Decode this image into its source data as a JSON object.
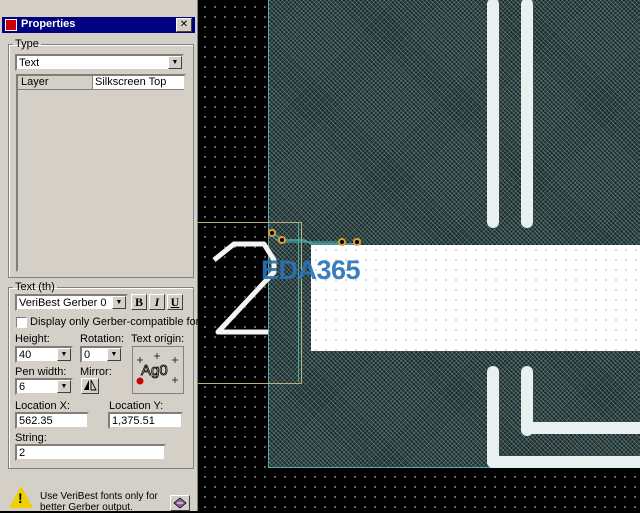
{
  "window": {
    "title": "Properties",
    "close_glyph": "✕"
  },
  "type_group": {
    "label": "Type",
    "selected": "Text"
  },
  "layer_table": {
    "key": "Layer",
    "value": "Silkscreen Top"
  },
  "text_group": {
    "label": "Text (th)",
    "font": "VeriBest Gerber 0",
    "bold": "B",
    "italic": "I",
    "underline": "U",
    "gerber_only_label": "Display only Gerber-compatible fonts",
    "height_label": "Height:",
    "height_value": "40",
    "rotation_label": "Rotation:",
    "rotation_value": "0",
    "origin_label": "Text origin:",
    "pen_width_label": "Pen width:",
    "pen_width_value": "6",
    "mirror_label": "Mirror:",
    "location_x_label": "Location X:",
    "location_x_value": "562.35",
    "location_y_label": "Location Y:",
    "location_y_value": "1,375.51",
    "string_label": "String:",
    "string_value": "2"
  },
  "warning": {
    "text": "Use VeriBest fonts only for better Gerber output."
  },
  "canvas": {
    "selected_text": "2",
    "watermark": "EDA365"
  },
  "icons": {
    "close": "close-icon",
    "warning": "warning-icon",
    "help": "help-icon",
    "app": "app-icon",
    "mirror": "mirror-icon",
    "origin": "text-origin-icon"
  },
  "colors": {
    "titlebar": "#000080",
    "panel": "#d4d0c8",
    "board": "#1c2a2a",
    "copper": "#ffffff",
    "outline": "#4fb0b0",
    "drill": "#e0a030",
    "watermark": "#2a74b8"
  }
}
